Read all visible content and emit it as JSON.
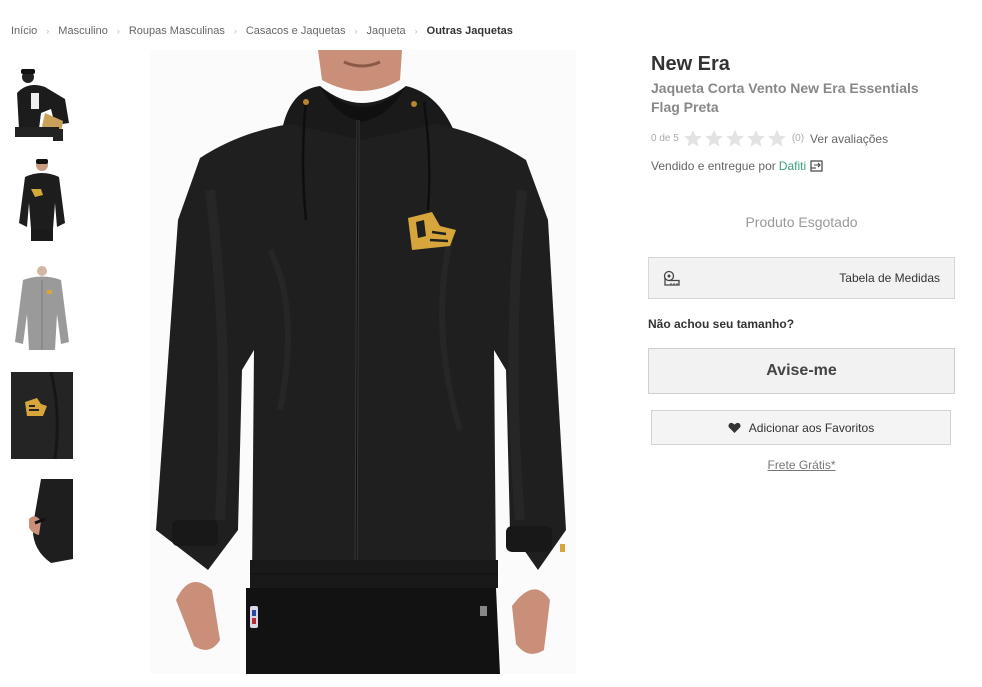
{
  "breadcrumb": {
    "items": [
      "Início",
      "Masculino",
      "Roupas Masculinas",
      "Casacos e Jaquetas",
      "Jaqueta"
    ],
    "current": "Outras Jaquetas",
    "separator": "›"
  },
  "gallery": {
    "thumbnails": [
      "thumbnail-model-seated",
      "thumbnail-jacket-front",
      "thumbnail-jacket-grey",
      "thumbnail-logo-detail",
      "thumbnail-sleeve-detail"
    ],
    "main_image": "main-product-photo"
  },
  "product": {
    "brand": "New Era",
    "name": "Jaqueta Corta Vento New Era Essentials Flag Preta"
  },
  "rating": {
    "label": "0 de 5",
    "stars": 0,
    "max_stars": 5,
    "count": "(0)",
    "link": "Ver avaliações"
  },
  "seller": {
    "text": "Vendido e entregue por",
    "name": "Dafiti",
    "icon": "store-exchange-icon"
  },
  "status": {
    "sold_out": "Produto Esgotado"
  },
  "size_table": {
    "label": "Tabela de Medidas",
    "icon": "measuring-tape-icon"
  },
  "no_size": {
    "text": "Não achou seu tamanho?"
  },
  "notify": {
    "label": "Avise-me"
  },
  "favorite": {
    "label": "Adicionar aos Favoritos",
    "icon": "heart-icon"
  },
  "shipping": {
    "label": "Frete Grátis*"
  },
  "colors": {
    "accent_green": "#3aa17e",
    "button_bg": "#f2f2f2",
    "logo_gold": "#d6a53c"
  }
}
